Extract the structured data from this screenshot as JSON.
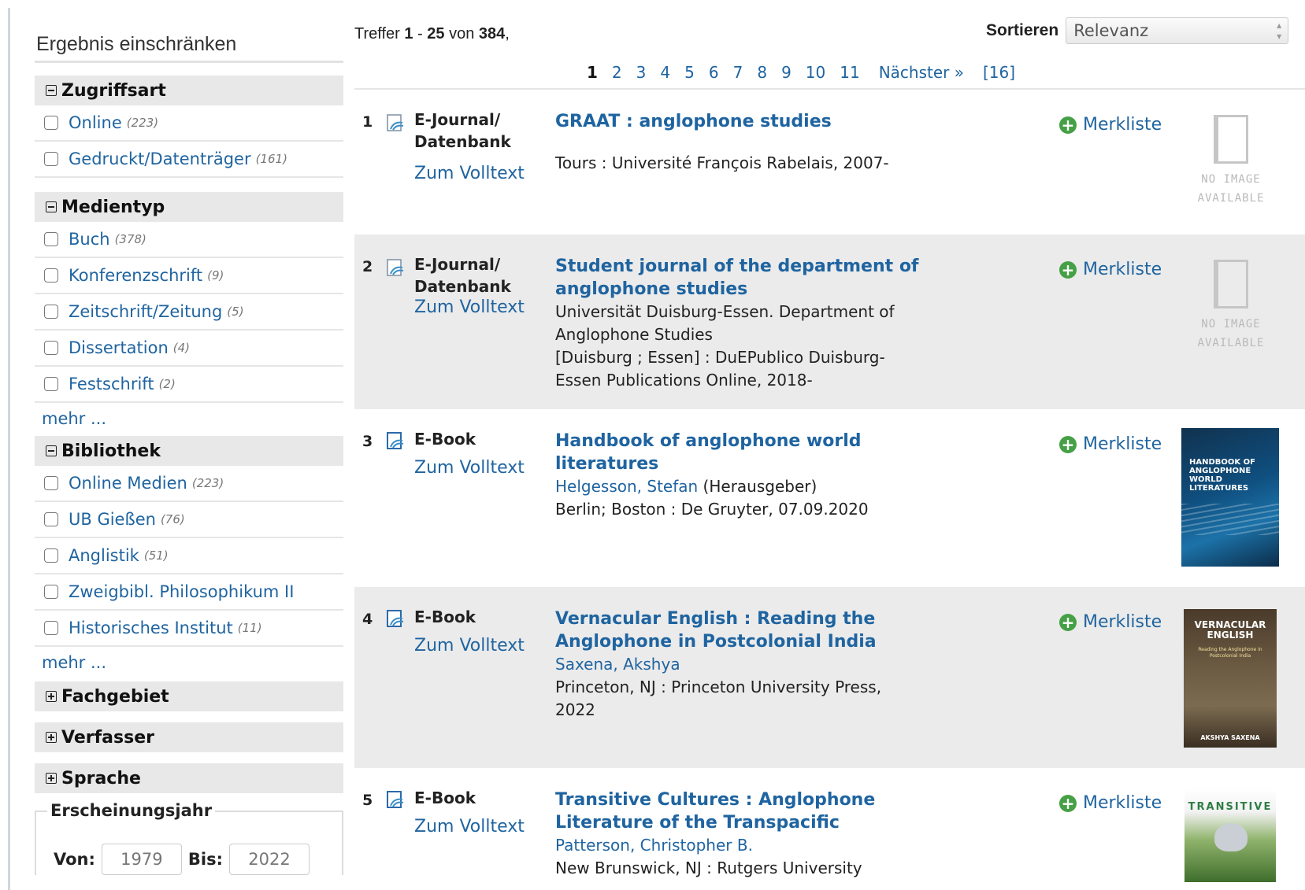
{
  "sidebar": {
    "title": "Ergebnis einschränken",
    "facets": [
      {
        "label": "Zugriffsart",
        "items": [
          {
            "label": "Online",
            "count": "(223)"
          },
          {
            "label": "Gedruckt/Datenträger",
            "count": "(161)"
          }
        ]
      },
      {
        "label": "Medientyp",
        "items": [
          {
            "label": "Buch",
            "count": "(378)"
          },
          {
            "label": "Konferenzschrift",
            "count": "(9)"
          },
          {
            "label": "Zeitschrift/Zeitung",
            "count": "(5)"
          },
          {
            "label": "Dissertation",
            "count": "(4)"
          },
          {
            "label": "Festschrift",
            "count": "(2)"
          }
        ],
        "more": "mehr ..."
      },
      {
        "label": "Bibliothek",
        "items": [
          {
            "label": "Online Medien",
            "count": "(223)"
          },
          {
            "label": "UB Gießen",
            "count": "(76)"
          },
          {
            "label": "Anglistik",
            "count": "(51)"
          },
          {
            "label": "Zweigbibl. Philosophikum II",
            "count": ""
          },
          {
            "label": "Historisches Institut",
            "count": "(11)"
          }
        ],
        "more": "mehr ..."
      }
    ],
    "collapsed": [
      "Fachgebiet",
      "Verfasser",
      "Sprache"
    ],
    "year": {
      "legend": "Erscheinungsjahr",
      "from_label": "Von:",
      "from_placeholder": "1979",
      "to_label": "Bis:",
      "to_placeholder": "2022"
    }
  },
  "hits": {
    "prefix": "Treffer",
    "from": "1",
    "dash": "-",
    "to": "25",
    "of": "von",
    "total": "384",
    "suffix": ","
  },
  "sort": {
    "label": "Sortieren",
    "value": "Relevanz"
  },
  "pager": {
    "pages": [
      "1",
      "2",
      "3",
      "4",
      "5",
      "6",
      "7",
      "8",
      "9",
      "10",
      "11"
    ],
    "current": "1",
    "next": "Nächster »",
    "last": "[16]"
  },
  "results": [
    {
      "num": "1",
      "format": "E-Journal/ Datenbank",
      "fulltext": "Zum Volltext",
      "title": "GRAAT : anglophone studies",
      "lines": [
        "Tours : Université François Rabelais, 2007-"
      ],
      "author": "",
      "author_role": "",
      "merkliste": "Merkliste",
      "image": "none",
      "noimage": "NO IMAGE AVAILABLE"
    },
    {
      "num": "2",
      "format": "E-Journal/ Datenbank",
      "fulltext": "Zum Volltext",
      "title": "Student journal of the department of anglophone studies",
      "lines": [
        "Universität Duisburg-Essen. Department of Anglophone Studies",
        "[Duisburg ; Essen] : DuEPublico Duisburg-Essen Publications Online, 2018-"
      ],
      "author": "",
      "author_role": "",
      "merkliste": "Merkliste",
      "image": "none",
      "noimage": "NO IMAGE AVAILABLE"
    },
    {
      "num": "3",
      "format": "E-Book",
      "fulltext": "Zum Volltext",
      "title": "Handbook of anglophone world literatures",
      "author": "Helgesson, Stefan",
      "author_role": "(Herausgeber)",
      "lines": [
        "Berlin; Boston : De Gruyter, 07.09.2020"
      ],
      "merkliste": "Merkliste",
      "image": "cover",
      "cover_text": "HANDBOOK OF ANGLOPHONE WORLD LITERATURES"
    },
    {
      "num": "4",
      "format": "E-Book",
      "fulltext": "Zum Volltext",
      "title": "Vernacular English : Reading the Anglophone in Postcolonial India",
      "author": "Saxena, Akshya",
      "author_role": "",
      "lines": [
        "Princeton, NJ : Princeton University Press, 2022"
      ],
      "merkliste": "Merkliste",
      "image": "cover",
      "cover_text": "VERNACULAR ENGLISH",
      "cover_sub": "Reading the Anglophone in Postcolonial India",
      "cover_author": "AKSHYA SAXENA"
    },
    {
      "num": "5",
      "format": "E-Book",
      "fulltext": "Zum Volltext",
      "title": "Transitive Cultures : Anglophone Literature of the Transpacific",
      "author": "Patterson, Christopher B.",
      "author_role": "",
      "lines": [
        "New Brunswick, NJ : Rutgers University"
      ],
      "merkliste": "Merkliste",
      "image": "cover",
      "cover_text": "TRANSITIVE"
    }
  ],
  "colors": {
    "link": "#1f64a0",
    "shade": "#ebebeb",
    "facet_header": "#e8e8e8",
    "add_green": "#46a046"
  }
}
